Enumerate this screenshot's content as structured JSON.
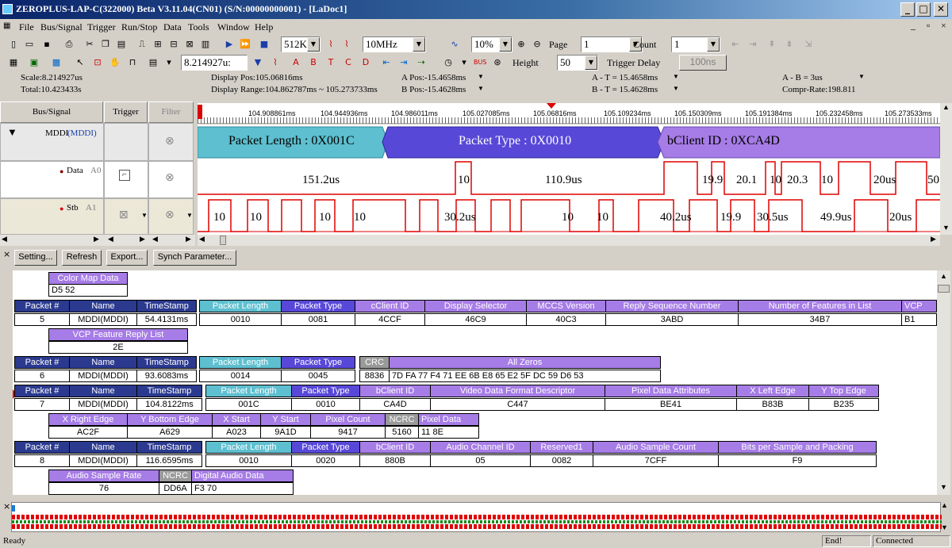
{
  "window": {
    "title": "ZEROPLUS-LAP-C(322000) Beta V3.11.04(CN01) (S/N:00000000001) - [LaDoc1]"
  },
  "menu": [
    "File",
    "Bus/Signal",
    "Trigger",
    "Run/Stop",
    "Data",
    "Tools",
    "Window",
    "Help"
  ],
  "toolbar": {
    "memory": "512K",
    "frequency": "10MHz",
    "zoom": "10%",
    "page_label": "Page",
    "page_value": "1",
    "count_label": "Count",
    "count_value": "1",
    "time_value": "8.214927u:",
    "height_label": "Height",
    "height_value": "50",
    "trigger_delay_label": "Trigger Delay",
    "trigger_delay_value": "100ns"
  },
  "info": {
    "scale": "Scale:8.214927us",
    "total": "Total:10.423433s",
    "display_pos": "Display Pos:105.06816ms",
    "display_range": "Display Range:104.862787ms ~ 105.273733ms",
    "a_pos": "A Pos:-15.4658ms",
    "b_pos": "B Pos:-15.4628ms",
    "a_t": "A - T = 15.4658ms",
    "b_t": "B - T = 15.4628ms",
    "a_b": "A - B = 3us",
    "compr": "Compr-Rate:198.811"
  },
  "headers": {
    "bus": "Bus/Signal",
    "trigger": "Trigger",
    "filter": "Filter"
  },
  "signals": {
    "bus_name": "MDDI",
    "bus_type": "(MDDI)",
    "data_name": "Data",
    "data_ch": "A0",
    "stb_name": "Stb",
    "stb_ch": "A1"
  },
  "ruler": [
    "104.908861ms",
    "104.944936ms",
    "104.986011ms",
    "105.027085ms",
    "105.06816ms",
    "105.109234ms",
    "105.150309ms",
    "105.191384ms",
    "105.232458ms",
    "105.273533ms"
  ],
  "bus_segments": [
    "Packet Length : 0X001C",
    "Packet Type : 0X0010",
    "bClient ID : 0XCA4D"
  ],
  "data_labels": [
    "151.2us",
    "10",
    "110.9us",
    "19.9",
    "20.1",
    "10",
    "20.3",
    "10",
    "20us",
    "50"
  ],
  "stb_labels": [
    "10",
    "10",
    "10",
    "10",
    "30.2us",
    "10",
    "10",
    "40.2us",
    "19.9",
    "30.5us",
    "49.9us",
    "20us"
  ],
  "buttons": {
    "setting": "Setting...",
    "refresh": "Refresh",
    "export": "Export...",
    "synch": "Synch Parameter..."
  },
  "packets": {
    "cmap_header": "Color Map Data",
    "cmap_value": "D5  52",
    "common_headers": [
      "Packet #",
      "Name",
      "TimeStamp",
      "Packet Length",
      "Packet Type"
    ],
    "p5": {
      "num": "5",
      "name": "MDDI(MDDI)",
      "ts": "54.4131ms",
      "len": "0010",
      "type": "0081",
      "h": [
        "cClient ID",
        "Display Selector",
        "MCCS Version",
        "Reply Sequence Number",
        "Number of Features in List",
        "VCP"
      ],
      "v": [
        "4CCF",
        "46C9",
        "40C3",
        "3ABD",
        "34B7",
        "B1"
      ],
      "h2": "VCP Feature Reply List",
      "v2": "2E"
    },
    "p6": {
      "num": "6",
      "name": "MDDI(MDDI)",
      "ts": "93.6083ms",
      "len": "0014",
      "type": "0045",
      "h": [
        "CRC",
        "All Zeros"
      ],
      "v": [
        "8836",
        "7D  FA  77  F4  71  EE  6B  E8  65  E2  5F  DC  59  D6  53"
      ]
    },
    "p7": {
      "num": "7",
      "name": "MDDI(MDDI)",
      "ts": "104.8122ms",
      "len": "001C",
      "type": "0010",
      "h": [
        "bClient ID",
        "Video Data Format Descriptor",
        "Pixel Data Attributes",
        "X Left Edge",
        "Y Top Edge"
      ],
      "v": [
        "CA4D",
        "C447",
        "BE41",
        "B83B",
        "B235"
      ],
      "h2": [
        "X Right Edge",
        "Y Bottom Edge",
        "X Start",
        "Y Start",
        "Pixel Count",
        "NCRC",
        "Pixel Data"
      ],
      "v2": [
        "AC2F",
        "A629",
        "A023",
        "9A1D",
        "9417",
        "5160",
        "11  8E"
      ]
    },
    "p8": {
      "num": "8",
      "name": "MDDI(MDDI)",
      "ts": "116.6595ms",
      "len": "0010",
      "type": "0020",
      "h": [
        "bClient ID",
        "Audio Channel ID",
        "Reserved1",
        "Audio Sample Count",
        "Bits per Sample and Packing"
      ],
      "v": [
        "880B",
        "05",
        "0082",
        "7CFF",
        "F9"
      ],
      "h2": [
        "Audio Sample Rate",
        "NCRC",
        "Digital Audio Data"
      ],
      "v2": [
        "76",
        "DD6A",
        "F3  70"
      ]
    }
  },
  "status": {
    "ready": "Ready",
    "end": "End!",
    "connected": "Connected"
  },
  "colors": {
    "title_bg": "#0a246a",
    "bus_blue": "#5dbfcf",
    "bus_purple": "#5848d8",
    "bus_violet": "#a67ce6",
    "wave_red": "#e00000"
  }
}
